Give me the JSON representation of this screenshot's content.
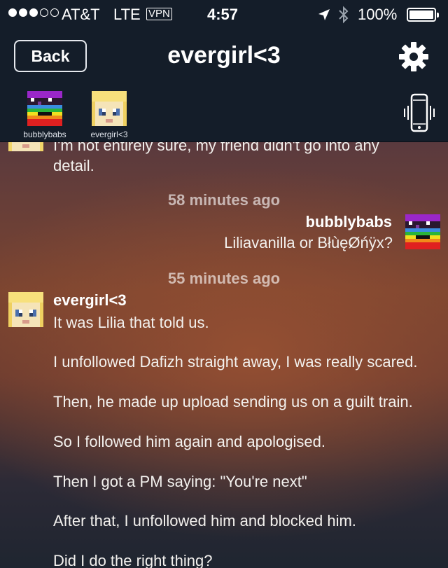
{
  "status_bar": {
    "signal": "●●●○○",
    "carrier": "AT&T",
    "network": "LTE",
    "vpn": "VPN",
    "time": "4:57",
    "battery_percent": "100%"
  },
  "nav": {
    "back_label": "Back",
    "title": "evergirl<3"
  },
  "participants": [
    {
      "name": "bubblybabs",
      "avatar": "rainbow-pixel-avatar"
    },
    {
      "name": "evergirl<3",
      "avatar": "blonde-pixel-avatar"
    }
  ],
  "messages": [
    {
      "sender": "evergirl<3",
      "lines": [
        "I'm not entirely sure, my friend didn't go into any",
        "detail."
      ]
    },
    {
      "timestamp": "58 minutes ago",
      "sender": "bubblybabs",
      "text": "Liliavanilla or BłùęØńÿx?"
    },
    {
      "timestamp": "55 minutes ago",
      "sender": "evergirl<3",
      "paragraphs": [
        "It was Lilia that told us.",
        "I unfollowed Dafizh straight away, I was really scared.",
        "Then, he made up upload sending us on a guilt train.",
        "So I followed him again and apologised.",
        "Then I got a PM saying: \"You're next\"",
        "After that, I unfollowed him and blocked him.",
        "Did I do the right thing?"
      ]
    }
  ],
  "colors": {
    "header_bg": "#141d29",
    "timestamp": "rgba(255,255,255,0.62)",
    "text": "#f3f1ee"
  },
  "icons": [
    "location-arrow-icon",
    "bluetooth-icon",
    "battery-icon",
    "gear-icon",
    "phone-vibrate-icon"
  ]
}
